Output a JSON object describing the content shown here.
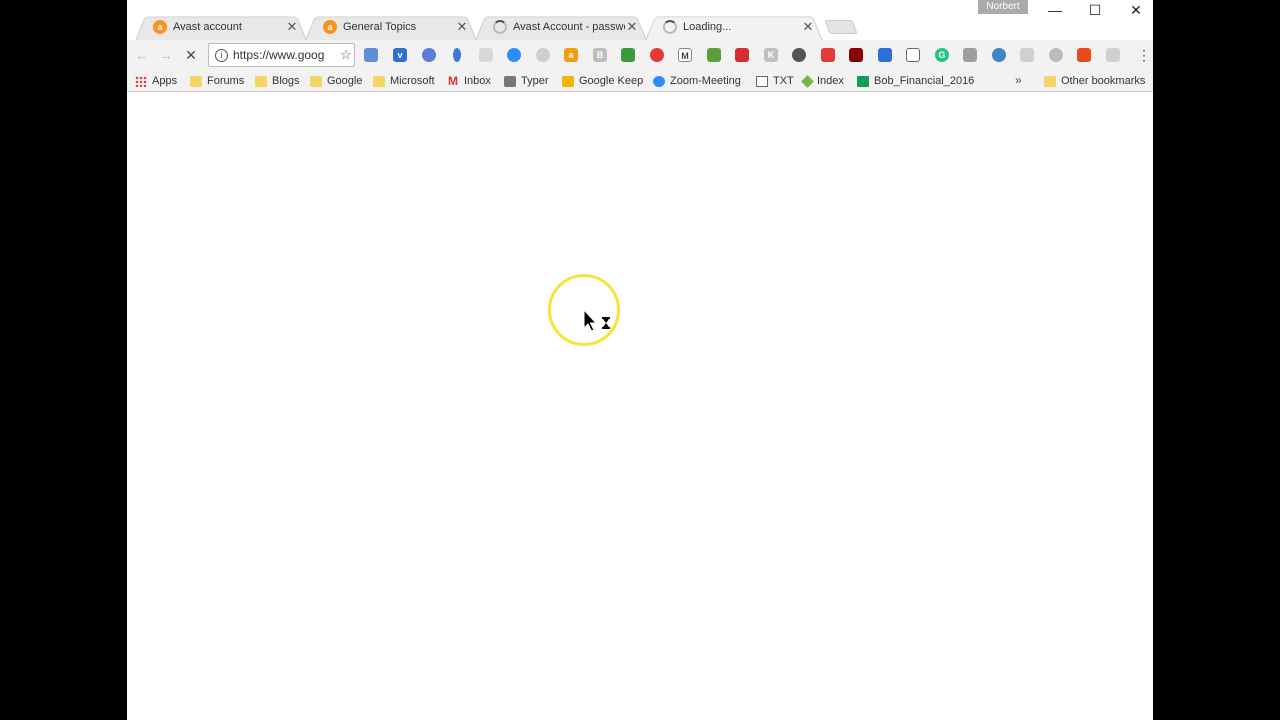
{
  "tabs": [
    {
      "title": "Avast account",
      "favicon": "avast-icon",
      "active": false
    },
    {
      "title": "General Topics",
      "favicon": "avast-icon",
      "active": false
    },
    {
      "title": "Avast Account - passwo",
      "favicon": "loading-spinner-icon",
      "active": false
    },
    {
      "title": "Loading...",
      "favicon": "loading-spinner-icon",
      "active": true
    }
  ],
  "profile": {
    "name": "Norbert"
  },
  "omnibox": {
    "url": "https://www.goog"
  },
  "bookmarks": [
    {
      "label": "Apps"
    },
    {
      "label": "Forums"
    },
    {
      "label": "Blogs"
    },
    {
      "label": "Google"
    },
    {
      "label": "Microsoft"
    },
    {
      "label": "Inbox"
    },
    {
      "label": "Typer"
    },
    {
      "label": "Google Keep"
    },
    {
      "label": "Zoom-Meeting"
    },
    {
      "label": "TXT"
    },
    {
      "label": "Index"
    },
    {
      "label": "Bob_Financial_2016"
    },
    {
      "label": "Other bookmarks"
    }
  ],
  "colors": {
    "cursor_highlight": "#f4e53a",
    "avast": "#f7931e"
  }
}
